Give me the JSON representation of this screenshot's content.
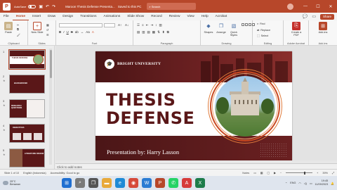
{
  "titlebar": {
    "autosave_label": "AutoSave",
    "autosave_state": "Off",
    "doc_title": "Maroon Thesis Defense Presenta...",
    "saved_label": "Saved to this PC",
    "search_placeholder": "Search",
    "minimize": "—",
    "maximize": "☐",
    "close": "✕"
  },
  "menu": {
    "tabs": [
      "File",
      "Home",
      "Insert",
      "Draw",
      "Design",
      "Transitions",
      "Animations",
      "Slide Show",
      "Record",
      "Review",
      "View",
      "Help",
      "Acrobat"
    ],
    "active_tab": "Home",
    "share_label": "Share"
  },
  "ribbon": {
    "clipboard": {
      "paste_label": "Paste",
      "group_label": "Clipboard"
    },
    "slides": {
      "new_slide_label": "New Slide",
      "group_label": "Slides"
    },
    "font": {
      "group_label": "Font",
      "bold": "B",
      "italic": "I",
      "underline": "U",
      "strike": "S"
    },
    "paragraph": {
      "group_label": "Paragraph"
    },
    "drawing": {
      "shapes_label": "Shapes",
      "arrange_label": "Arrange",
      "quick_styles_label": "Quick Styles",
      "group_label": "Drawing"
    },
    "editing": {
      "find_label": "Find",
      "replace_label": "Replace",
      "select_label": "Select",
      "group_label": "Editing"
    },
    "adobe": {
      "create_pdf_label": "Create a PDF",
      "group_label": "Adobe Acrobat"
    },
    "addins": {
      "addins_label": "Add-ins",
      "group_label": "Add-ins"
    }
  },
  "thumbnails": [
    {
      "num": "1",
      "text": "THESIS DEFENSE",
      "selected": true
    },
    {
      "num": "2",
      "text": "BACKGROUND"
    },
    {
      "num": "3",
      "text": "RESEARCH QUESTIONS"
    },
    {
      "num": "4",
      "text": "OBJECTIVES"
    },
    {
      "num": "5",
      "text": "LITERATURE REVIEW"
    }
  ],
  "slide": {
    "university": "BRIGHT UNIVERSITY",
    "title_line1": "THESIS",
    "title_line2": "DEFENSE",
    "presenter": "Presentation by: Harry Lasson"
  },
  "notes": {
    "placeholder": "Click to add notes"
  },
  "status": {
    "slide_info": "Slide 1 of 10",
    "language": "English (Indonesia)",
    "accessibility": "Accessibility: Good to go",
    "notes_label": "Notes",
    "zoom": "39%"
  },
  "taskbar": {
    "weather_temp": "25°C",
    "weather_desc": "Berawan",
    "time": "19:45",
    "date": "11/09/2023",
    "lang": "ENG"
  },
  "colors": {
    "accent": "#b7472a",
    "maroon": "#5e1a1b"
  }
}
